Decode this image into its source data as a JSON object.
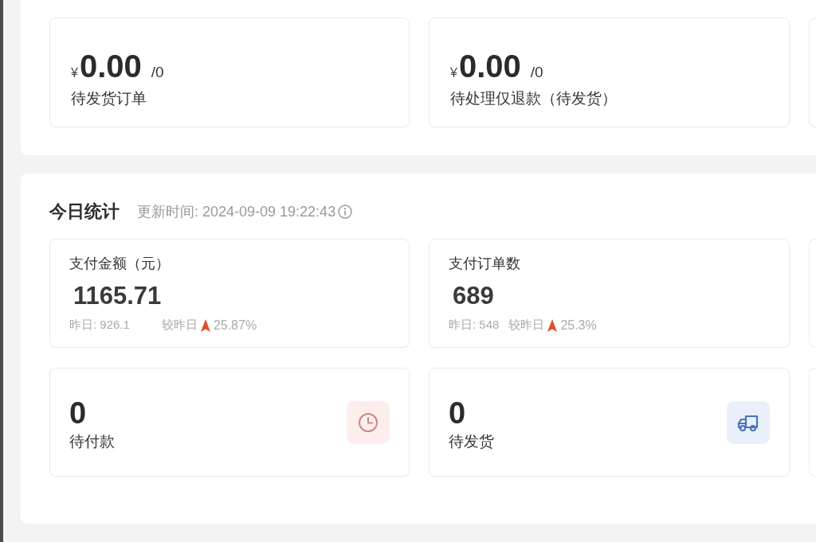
{
  "order_summary": {
    "cards": [
      {
        "currency": "¥",
        "amount": "0.00",
        "count": "/0",
        "label": "待发货订单"
      },
      {
        "currency": "¥",
        "amount": "0.00",
        "count": "/0",
        "label": "待处理仅退款（待发货）"
      }
    ]
  },
  "today_stats": {
    "title": "今日统计",
    "updated": "更新时间: 2024-09-09 19:22:43",
    "metrics": [
      {
        "title": "支付金额（元）",
        "value": "1165.71",
        "yesterday": "昨日: 926.1",
        "compare_label": "较昨日",
        "increased": true,
        "change": "25.87%"
      },
      {
        "title": "支付订单数",
        "value": "689",
        "yesterday": "昨日: 548",
        "compare_label": "较昨日",
        "increased": true,
        "change": "25.3%"
      }
    ],
    "pending": [
      {
        "kind": "payment",
        "value": "0",
        "label": "待付款"
      },
      {
        "kind": "shipping",
        "value": "0",
        "label": "待发货"
      }
    ]
  }
}
